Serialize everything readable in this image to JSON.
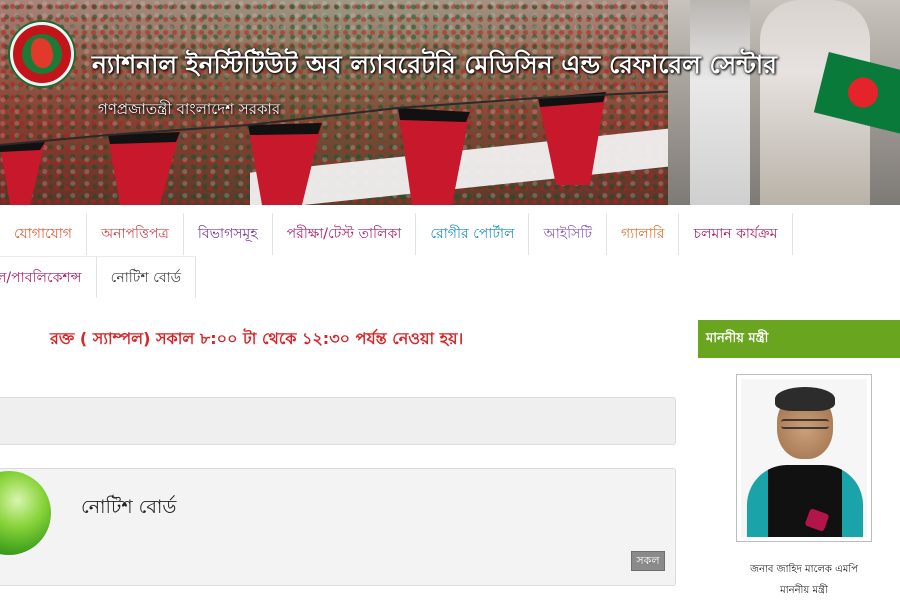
{
  "header": {
    "title": "ন্যাশনাল ইনস্টিটিউট অব ল্যাবরেটরি মেডিসিন এন্ড রেফারেল সেন্টার",
    "subtitle": "গণপ্রজাতন্ত্রী বাংলাদেশ সরকার"
  },
  "nav": {
    "row1": [
      {
        "label": "যোগাযোগ",
        "color": "#e4572e"
      },
      {
        "label": "অনাপত্তিপত্র",
        "color": "#d2474a"
      },
      {
        "label": "বিভাগসমূহ",
        "color": "#7b3a9b"
      },
      {
        "label": "পরীক্ষা/টেস্ট তালিকা",
        "color": "#b1206c"
      },
      {
        "label": "রোগীর পোর্টাল",
        "color": "#1d8ec2"
      },
      {
        "label": "আইসিটি",
        "color": "#8b5bc4"
      },
      {
        "label": "গ্যালারি",
        "color": "#e0702b"
      },
      {
        "label": "চলমান কার্যক্রম",
        "color": "#b71e5c"
      }
    ],
    "row2": [
      {
        "label": "ল/পাবলিকেশন্স",
        "color": "#b1206c"
      },
      {
        "label": "নোটিশ বোর্ড",
        "color": "#444444"
      }
    ]
  },
  "main": {
    "notice": "রক্ত ( স্যাম্পল) সকাল ৮:০০ টা থেকে ১২:৩০ পর্যন্ত নেওয়া হয়।",
    "board_title": "নোটিশ বোর্ড",
    "board_all_button": "সকল"
  },
  "sidebar": {
    "heading": "মাননীয় মন্ত্রী",
    "minister_name": "জনাব জাহিদ মালেক এমপি",
    "minister_title": "মাননীয় মন্ত্রী"
  },
  "colors": {
    "accent_green": "#6aa51f",
    "notice_red": "#d7262a",
    "flag_green": "#0a7a3b",
    "flag_red": "#e4232a"
  }
}
